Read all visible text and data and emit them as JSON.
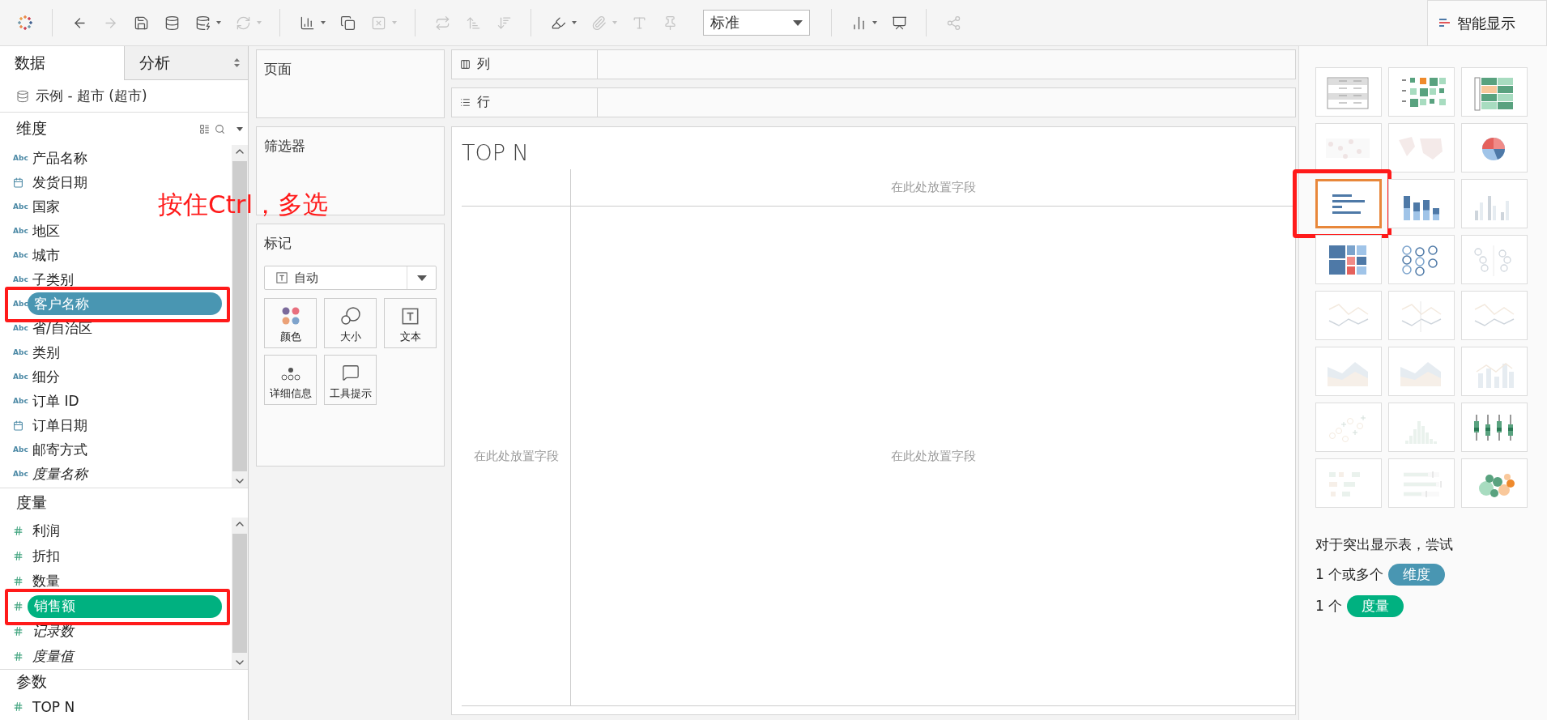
{
  "toolbar": {
    "items": [
      {
        "kind": "logo"
      },
      {
        "kind": "separator"
      },
      {
        "kind": "back",
        "disabled": false
      },
      {
        "kind": "forward",
        "disabled": true
      },
      {
        "kind": "save",
        "disabled": false
      },
      {
        "kind": "new_source",
        "disabled": false
      },
      {
        "kind": "pause_source",
        "disabled": false
      },
      {
        "kind": "caret",
        "disabled": false
      },
      {
        "kind": "refresh",
        "disabled": true
      },
      {
        "kind": "caret",
        "disabled": true
      },
      {
        "kind": "separator"
      },
      {
        "kind": "new_sheet",
        "disabled": false
      },
      {
        "kind": "caret",
        "disabled": false
      },
      {
        "kind": "duplicate",
        "disabled": false
      },
      {
        "kind": "clear",
        "disabled": true
      },
      {
        "kind": "caret",
        "disabled": true
      },
      {
        "kind": "separator"
      },
      {
        "kind": "swap",
        "disabled": true
      },
      {
        "kind": "sort_asc",
        "disabled": true
      },
      {
        "kind": "sort_desc",
        "disabled": true
      },
      {
        "kind": "separator"
      },
      {
        "kind": "highlight",
        "disabled": false
      },
      {
        "kind": "caret",
        "disabled": false
      },
      {
        "kind": "attach",
        "disabled": true
      },
      {
        "kind": "caret",
        "disabled": true
      },
      {
        "kind": "label",
        "disabled": true
      },
      {
        "kind": "pin",
        "disabled": true
      },
      {
        "kind": "fit"
      },
      {
        "kind": "separator"
      },
      {
        "kind": "show_cards",
        "disabled": false
      },
      {
        "kind": "caret",
        "disabled": false
      },
      {
        "kind": "present",
        "disabled": false
      },
      {
        "kind": "separator"
      },
      {
        "kind": "share",
        "disabled": true
      }
    ],
    "fit_value": "标准"
  },
  "data_pane": {
    "tabs": [
      {
        "label": "数据",
        "selected": true
      },
      {
        "label": "分析",
        "selected": false
      }
    ],
    "data_source": "示例 - 超市 (超市)",
    "dimensions": {
      "title": "维度",
      "fields": [
        {
          "name": "产品名称",
          "kind": "text",
          "type_icon": "Abc",
          "italic": false,
          "selected": false,
          "outlined": false
        },
        {
          "name": "发货日期",
          "kind": "date",
          "italic": false,
          "selected": false,
          "outlined": false
        },
        {
          "name": "国家",
          "kind": "text",
          "type_icon": "Abc",
          "italic": false,
          "selected": false,
          "outlined": false
        },
        {
          "name": "地区",
          "kind": "text",
          "type_icon": "Abc",
          "italic": false,
          "selected": false,
          "outlined": false
        },
        {
          "name": "城市",
          "kind": "text",
          "type_icon": "Abc",
          "italic": false,
          "selected": false,
          "outlined": false
        },
        {
          "name": "子类别",
          "kind": "text",
          "type_icon": "Abc",
          "italic": false,
          "selected": false,
          "outlined": false
        },
        {
          "name": "客户名称",
          "kind": "text",
          "type_icon": "Abc",
          "italic": false,
          "selected": true,
          "outlined": true
        },
        {
          "name": "省/自治区",
          "kind": "text",
          "type_icon": "Abc",
          "italic": false,
          "selected": false,
          "outlined": false
        },
        {
          "name": "类别",
          "kind": "text",
          "type_icon": "Abc",
          "italic": false,
          "selected": false,
          "outlined": false
        },
        {
          "name": "细分",
          "kind": "text",
          "type_icon": "Abc",
          "italic": false,
          "selected": false,
          "outlined": false
        },
        {
          "name": "订单 ID",
          "kind": "text",
          "type_icon": "Abc",
          "italic": false,
          "selected": false,
          "outlined": false
        },
        {
          "name": "订单日期",
          "kind": "date",
          "italic": false,
          "selected": false,
          "outlined": false
        },
        {
          "name": "邮寄方式",
          "kind": "text",
          "type_icon": "Abc",
          "italic": false,
          "selected": false,
          "outlined": false
        },
        {
          "name": "度量名称",
          "kind": "text",
          "type_icon": "Abc",
          "italic": true,
          "selected": false,
          "outlined": false
        }
      ]
    },
    "measures": {
      "title": "度量",
      "fields": [
        {
          "name": "利润",
          "kind": "number",
          "italic": false,
          "selected": false,
          "outlined": false
        },
        {
          "name": "折扣",
          "kind": "number",
          "italic": false,
          "selected": false,
          "outlined": false
        },
        {
          "name": "数量",
          "kind": "number",
          "italic": false,
          "selected": false,
          "outlined": false
        },
        {
          "name": "销售额",
          "kind": "number",
          "italic": false,
          "selected": true,
          "outlined": true
        },
        {
          "name": "记录数",
          "kind": "number",
          "italic": true,
          "selected": false,
          "outlined": false
        },
        {
          "name": "度量值",
          "kind": "number",
          "italic": true,
          "selected": false,
          "outlined": false
        }
      ]
    },
    "parameters": {
      "title": "参数",
      "fields": [
        {
          "name": "TOP N",
          "kind": "number",
          "italic": false,
          "selected": false
        }
      ]
    }
  },
  "shelves": {
    "pages": "页面",
    "filters": "筛选器",
    "marks": {
      "title": "标记",
      "mark_type": "自动",
      "cards": [
        {
          "label": "颜色",
          "kind": "color"
        },
        {
          "label": "大小",
          "kind": "size"
        },
        {
          "label": "文本",
          "kind": "text"
        },
        {
          "label": "详细信息",
          "kind": "detail"
        },
        {
          "label": "工具提示",
          "kind": "tooltip"
        }
      ]
    }
  },
  "columns_shelf": "列",
  "rows_shelf": "行",
  "view": {
    "title": "TOP N",
    "drop_zones": [
      "在此处放置字段",
      "在此处放置字段",
      "在此处放置字段"
    ]
  },
  "show_me": {
    "tab": "智能显示",
    "charts": [
      {
        "kind": "text_table",
        "disabled": false,
        "selected": false,
        "outlined": false
      },
      {
        "kind": "heat_map",
        "disabled": false,
        "selected": false,
        "outlined": false
      },
      {
        "kind": "highlight_table",
        "disabled": false,
        "selected": false,
        "outlined": false
      },
      {
        "kind": "symbol_map",
        "disabled": true,
        "selected": false,
        "outlined": false
      },
      {
        "kind": "filled_map",
        "disabled": true,
        "selected": false,
        "outlined": false
      },
      {
        "kind": "pie",
        "disabled": false,
        "selected": false,
        "outlined": false
      },
      {
        "kind": "hbar",
        "disabled": false,
        "selected": true,
        "outlined": true
      },
      {
        "kind": "stacked_bar",
        "disabled": false,
        "selected": false,
        "outlined": false
      },
      {
        "kind": "side_bar",
        "disabled": true,
        "selected": false,
        "outlined": false
      },
      {
        "kind": "treemap",
        "disabled": false,
        "selected": false,
        "outlined": false
      },
      {
        "kind": "circle",
        "disabled": false,
        "selected": false,
        "outlined": false
      },
      {
        "kind": "side_circle",
        "disabled": true,
        "selected": false,
        "outlined": false
      },
      {
        "kind": "line_cont",
        "disabled": true,
        "selected": false,
        "outlined": false
      },
      {
        "kind": "line_disc",
        "disabled": true,
        "selected": false,
        "outlined": false
      },
      {
        "kind": "dual_line",
        "disabled": true,
        "selected": false,
        "outlined": false
      },
      {
        "kind": "area_cont",
        "disabled": true,
        "selected": false,
        "outlined": false
      },
      {
        "kind": "area_disc",
        "disabled": true,
        "selected": false,
        "outlined": false
      },
      {
        "kind": "dual_combo",
        "disabled": true,
        "selected": false,
        "outlined": false
      },
      {
        "kind": "scatter",
        "disabled": true,
        "selected": false,
        "outlined": false
      },
      {
        "kind": "histogram",
        "disabled": true,
        "selected": false,
        "outlined": false
      },
      {
        "kind": "box_plot",
        "disabled": false,
        "selected": false,
        "outlined": false
      },
      {
        "kind": "gantt",
        "disabled": true,
        "selected": false,
        "outlined": false
      },
      {
        "kind": "bullet",
        "disabled": true,
        "selected": false,
        "outlined": false
      },
      {
        "kind": "bubbles",
        "disabled": false,
        "selected": false,
        "outlined": false
      }
    ],
    "hint": "对于突出显示表，尝试",
    "requirements": [
      {
        "count": "1 个或多个",
        "pill": "维度",
        "kind": "dimension"
      },
      {
        "count": "1 个",
        "pill": "度量",
        "kind": "measure"
      }
    ]
  },
  "annotation": {
    "text": "按住Ctrl，多选"
  }
}
